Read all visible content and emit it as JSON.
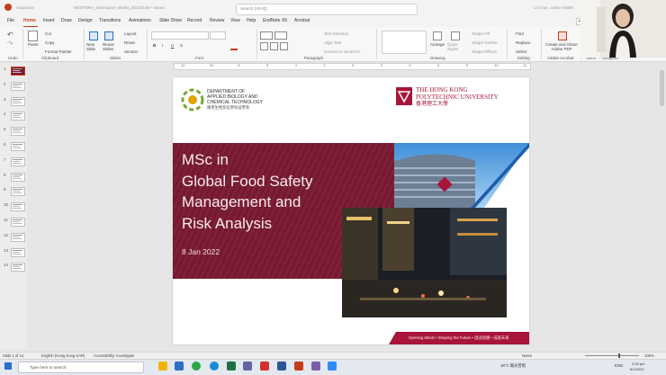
{
  "app": {
    "title_left": "AutoSave",
    "title_file": "MSGFSRA_Orientation_Slides_20220108 • Saved",
    "search_placeholder": "Search (Alt+Q)",
    "user": "LI Chan, Justin ANBM",
    "present_label": "Pre",
    "accent": "#c43e1c"
  },
  "tabs": [
    "File",
    "Home",
    "Insert",
    "Draw",
    "Design",
    "Transitions",
    "Animations",
    "Slide Show",
    "Record",
    "Review",
    "View",
    "Help",
    "EndNote X9",
    "Acrobat"
  ],
  "ribbon": {
    "undo_group": "Undo",
    "clipboard": {
      "paste": "Paste",
      "cut": "Cut",
      "copy": "Copy",
      "format_painter": "Format Painter",
      "label": "Clipboard"
    },
    "slides": {
      "new_slide": "New Slide",
      "reuse": "Reuse Slides",
      "layout": "Layout",
      "reset": "Reset",
      "section": "Section",
      "label": "Slides"
    },
    "font": {
      "label": "Font",
      "b": "B",
      "i": "I",
      "u": "U",
      "s": "S"
    },
    "paragraph": {
      "text_direction": "Text Direction",
      "align_text": "Align Text",
      "smartart": "Convert to SmartArt",
      "label": "Paragraph"
    },
    "drawing": {
      "arrange": "Arrange",
      "quick_styles": "Quick Styles",
      "shape_fill": "Shape Fill",
      "shape_outline": "Shape Outline",
      "shape_effects": "Shape Effects",
      "label": "Drawing"
    },
    "editing": {
      "find": "Find",
      "replace": "Replace",
      "select": "Select",
      "label": "Editing"
    },
    "acrobat": {
      "create": "Create and Share Adobe PDF",
      "label": "Adobe Acrobat"
    },
    "voice": {
      "dictate": "Dictate",
      "label": "Voice"
    },
    "designer": {
      "ideas": "Design Ideas",
      "label": "Designer"
    }
  },
  "ruler": [
    "12",
    "10",
    "8",
    "6",
    "4",
    "2",
    "0",
    "2",
    "4",
    "6",
    "8",
    "10",
    "12"
  ],
  "thumbnails": [
    "1",
    "2",
    "3",
    "4",
    "5",
    "6",
    "7",
    "8",
    "9",
    "10",
    "11",
    "12",
    "13",
    "14"
  ],
  "slide": {
    "dept_line1": "DEPARTMENT OF",
    "dept_line2": "APPLIED BIOLOGY AND",
    "dept_line3": "CHEMICAL TECHNOLOGY",
    "dept_chinese": "應用生物及化學科技學系",
    "univ_line1": "THE HONG KONG",
    "univ_line2": "POLYTECHNIC UNIVERSITY",
    "univ_chinese": "香港理工大學",
    "title_line1": "MSc in",
    "title_line2": "Global Food Safety",
    "title_line3": "Management and",
    "title_line4": "Risk Analysis",
    "date": "8 Jan 2022",
    "footer": "Opening Minds • Shaping the Future • 啟迪思維 • 成就未來",
    "maroon": "#7a1a32"
  },
  "status": {
    "slide_of": "Slide 1 of 14",
    "language": "English (Hong Kong SAR)",
    "accessibility": "Accessibility: Investigate",
    "notes": "Notes",
    "zoom": "106%"
  },
  "taskbar": {
    "search_placeholder": "Type here to search",
    "weather": "18°C 陽光普照",
    "lang": "ENG",
    "time": "2:00 pm",
    "date": "8/1/2022"
  }
}
